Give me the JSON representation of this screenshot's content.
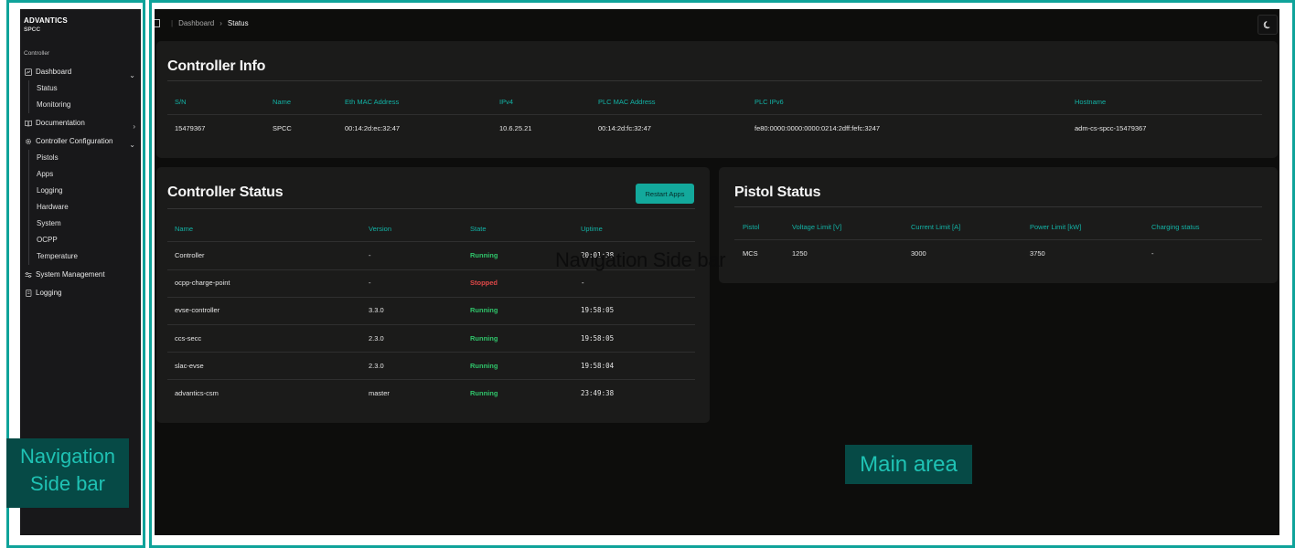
{
  "sidebar": {
    "brand": "ADVANTICS",
    "brand_sub": "SPCC",
    "section_label": "Controller",
    "dashboard": {
      "label": "Dashboard",
      "children": [
        "Status",
        "Monitoring"
      ]
    },
    "documentation": {
      "label": "Documentation"
    },
    "controller_configuration": {
      "label": "Controller Configuration",
      "children": [
        "Pistols",
        "Apps",
        "Logging",
        "Hardware",
        "System",
        "OCPP",
        "Temperature"
      ]
    },
    "system_management": {
      "label": "System Management"
    },
    "logging": {
      "label": "Logging"
    }
  },
  "breadcrumb": {
    "root": "Dashboard",
    "current": "Status"
  },
  "controller_info": {
    "title": "Controller Info",
    "headers": [
      "S/N",
      "Name",
      "Eth MAC Address",
      "IPv4",
      "PLC MAC Address",
      "PLC IPv6",
      "Hostname"
    ],
    "row": [
      "15479367",
      "SPCC",
      "00:14:2d:ec:32:47",
      "10.6.25.21",
      "00:14:2d:fc:32:47",
      "fe80:0000:0000:0000:0214:2dff:fefc:3247",
      "adm-cs-spcc-15479367"
    ]
  },
  "controller_status": {
    "title": "Controller Status",
    "restart_label": "Restart Apps",
    "headers": [
      "Name",
      "Version",
      "State",
      "Uptime"
    ],
    "rows": [
      [
        "Controller",
        "-",
        "Running",
        "20:01:38"
      ],
      [
        "ocpp-charge-point",
        "-",
        "Stopped",
        "-"
      ],
      [
        "evse-controller",
        "3.3.0",
        "Running",
        "19:58:05"
      ],
      [
        "ccs-secc",
        "2.3.0",
        "Running",
        "19:58:05"
      ],
      [
        "slac-evse",
        "2.3.0",
        "Running",
        "19:58:04"
      ],
      [
        "advantics-csm",
        "master",
        "Running",
        "23:49:38"
      ]
    ]
  },
  "pistol_status": {
    "title": "Pistol Status",
    "headers": [
      "Pistol",
      "Voltage Limit [V]",
      "Current Limit [A]",
      "Power Limit [kW]",
      "Charging status"
    ],
    "row": [
      "MCS",
      "1250",
      "3000",
      "3750",
      "-"
    ]
  },
  "annotations": {
    "nav_sidebar": "Navigation Side bar",
    "nav_sidebar_floating": "Navigation Side bar",
    "main_area": "Main area"
  },
  "colors": {
    "accent": "#13a99c",
    "running": "#2fc46a",
    "stopped": "#e04848",
    "annotation": "#0fa39a"
  }
}
